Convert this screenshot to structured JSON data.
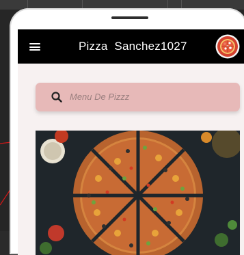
{
  "app": {
    "title": "Pizza  Sanchez1027"
  },
  "search": {
    "placeholder": "Menu De Pizzz"
  },
  "icons": {
    "menu": "menu-icon",
    "search": "search-icon",
    "logo": "pizza-logo-icon"
  },
  "colors": {
    "appbar": "#000000",
    "search_bg": "#e7b9b8",
    "content_bg": "#f7f1f1",
    "logo_bg": "#d4412e"
  }
}
